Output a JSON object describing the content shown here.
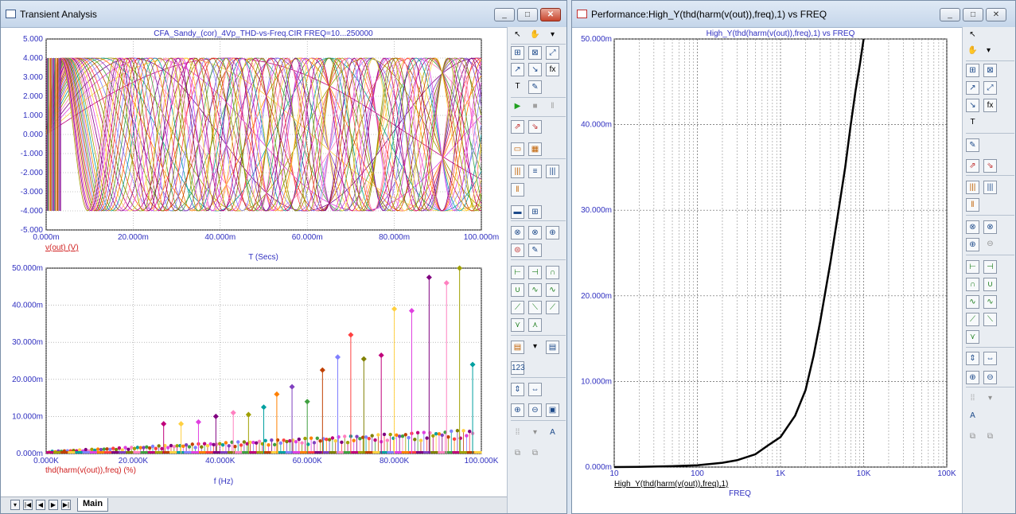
{
  "left_window": {
    "title": "Transient Analysis",
    "btn_minimize": "_",
    "btn_restore": "□",
    "btn_close": "✕",
    "tab_main": "Main",
    "top_plot": {
      "title": "CFA_Sandy_(cor)_4Vp_THD-vs-Freq.CIR FREQ=10...250000",
      "y_ticks": [
        "5.000",
        "4.000",
        "3.000",
        "2.000",
        "1.000",
        "0.000",
        "-1.000",
        "-2.000",
        "-3.000",
        "-4.000",
        "-5.000"
      ],
      "x_ticks": [
        "0.000m",
        "20.000m",
        "40.000m",
        "60.000m",
        "80.000m",
        "100.000m"
      ],
      "xlabel": "T (Secs)",
      "legend": "v(out) (V)"
    },
    "bottom_plot": {
      "y_ticks": [
        "50.000m",
        "40.000m",
        "30.000m",
        "20.000m",
        "10.000m",
        "0.000m"
      ],
      "x_ticks": [
        "0.000K",
        "20.000K",
        "40.000K",
        "60.000K",
        "80.000K",
        "100.000K"
      ],
      "xlabel": "f (Hz)",
      "legend": "thd(harm(v(out)),freq) (%)"
    }
  },
  "right_window": {
    "title": "Performance:High_Y(thd(harm(v(out)),freq),1) vs FREQ",
    "btn_minimize": "_",
    "btn_restore": "□",
    "btn_close": "✕",
    "plot": {
      "title": "High_Y(thd(harm(v(out)),freq),1) vs FREQ",
      "y_ticks": [
        "50.000m",
        "40.000m",
        "30.000m",
        "20.000m",
        "10.000m",
        "0.000m"
      ],
      "x_ticks": [
        "10",
        "100",
        "1K",
        "10K",
        "100K"
      ],
      "xlabel": "FREQ",
      "legend": "High_Y(thd(harm(v(out)),freq),1)"
    }
  },
  "chart_data": [
    {
      "type": "line",
      "title": "CFA_Sandy_(cor)_4Vp_THD-vs-Freq.CIR FREQ=10...250000",
      "xlabel": "T (Secs)",
      "ylabel": "",
      "xlim": [
        0,
        0.1
      ],
      "ylim": [
        -5,
        5
      ],
      "grid": true,
      "series": [
        {
          "name": "v(out) (V)",
          "amplitude": 4
        }
      ]
    },
    {
      "type": "scatter",
      "xlabel": "f (Hz)",
      "ylabel": "",
      "xlim": [
        0,
        100000
      ],
      "ylim": [
        0,
        0.05
      ],
      "grid": true,
      "series": [
        {
          "name": "thd(harm(v(out)),freq) (%)"
        }
      ],
      "x": [
        27000,
        31000,
        35000,
        39000,
        43000,
        46500,
        50000,
        53000,
        56500,
        60000,
        63500,
        67000,
        70000,
        73000,
        77000,
        80000,
        84000,
        88000,
        92000,
        95000,
        98000
      ],
      "values": [
        0.008,
        0.008,
        0.0085,
        0.01,
        0.011,
        0.0105,
        0.0125,
        0.016,
        0.018,
        0.014,
        0.0225,
        0.026,
        0.032,
        0.0255,
        0.0265,
        0.039,
        0.0385,
        0.0475,
        0.046,
        0.05,
        0.024
      ]
    },
    {
      "type": "line",
      "title": "High_Y(thd(harm(v(out)),freq),1) vs FREQ",
      "xlabel": "FREQ",
      "ylabel": "",
      "xscale": "log",
      "xlim": [
        10,
        100000
      ],
      "ylim": [
        0,
        0.05
      ],
      "grid": true,
      "series": [
        {
          "name": "High_Y(thd(harm(v(out)),freq),1)"
        }
      ],
      "x": [
        10,
        20,
        50,
        100,
        200,
        300,
        500,
        700,
        1000,
        1500,
        2000,
        2500,
        3000,
        4000,
        5000,
        6000,
        7000,
        8000,
        9000,
        10000
      ],
      "values": [
        0,
        2e-05,
        0.0001,
        0.0002,
        0.0005,
        0.0008,
        0.0015,
        0.0025,
        0.0035,
        0.006,
        0.009,
        0.013,
        0.017,
        0.024,
        0.03,
        0.035,
        0.04,
        0.044,
        0.047,
        0.05
      ]
    }
  ],
  "colors": {
    "trace_palette": [
      "#c0007a",
      "#ffd040",
      "#e040e0",
      "#800080",
      "#ff80c0",
      "#a0a000",
      "#00a0a0",
      "#ff8000",
      "#8040c0",
      "#40a040",
      "#c04000",
      "#8080ff",
      "#ff4040",
      "#808000"
    ],
    "axis_label_blue": "#3030c0",
    "legend_red": "#d02020",
    "grid": "#808080"
  }
}
